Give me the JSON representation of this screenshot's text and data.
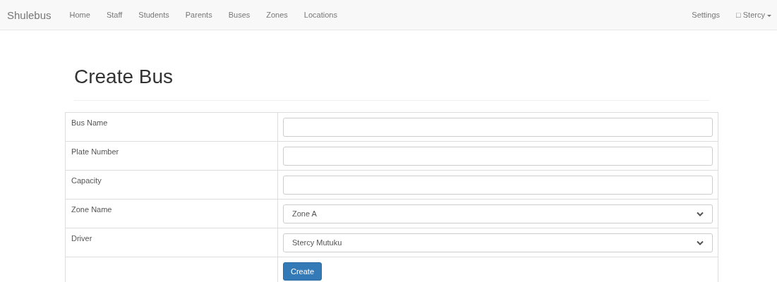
{
  "navbar": {
    "brand": "Shulebus",
    "items": [
      {
        "label": "Home"
      },
      {
        "label": "Staff"
      },
      {
        "label": "Students"
      },
      {
        "label": "Parents"
      },
      {
        "label": "Buses"
      },
      {
        "label": "Zones"
      },
      {
        "label": "Locations"
      }
    ],
    "right": {
      "settings": "Settings",
      "user_icon": "□",
      "user": "Stercy"
    }
  },
  "heading": "Create Bus",
  "fields": [
    {
      "label": "Bus Name",
      "kind": "text"
    },
    {
      "label": "Plate Number",
      "kind": "text"
    },
    {
      "label": "Capacity",
      "kind": "text"
    },
    {
      "label": "Zone Name",
      "kind": "select",
      "value": "Zone A"
    },
    {
      "label": "Driver",
      "kind": "select",
      "value": "Stercy Mutuku"
    }
  ],
  "submit": "Create"
}
